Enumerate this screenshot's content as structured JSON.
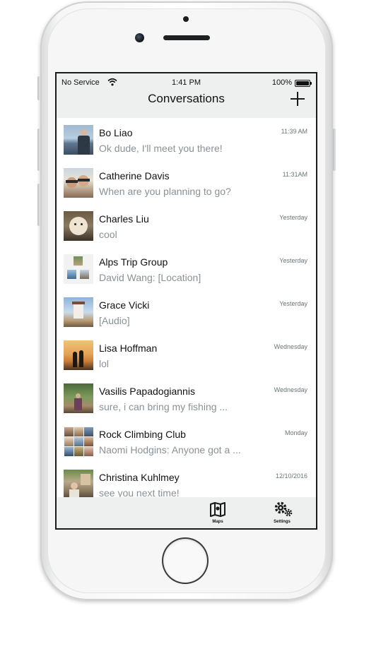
{
  "status_bar": {
    "carrier": "No Service",
    "time": "1:41 PM",
    "battery": "100%"
  },
  "nav": {
    "title": "Conversations",
    "add_icon": "plus-icon"
  },
  "conversations": [
    {
      "name": "Bo Liao",
      "preview": "Ok dude, I'll meet you there!",
      "time": "11:39 AM"
    },
    {
      "name": "Catherine Davis",
      "preview": "When are you planning to go?",
      "time": "11:31AM"
    },
    {
      "name": "Charles Liu",
      "preview": "cool",
      "time": "Yesterday"
    },
    {
      "name": "Alps Trip Group",
      "preview": "David Wang: [Location]",
      "time": "Yesterday"
    },
    {
      "name": "Grace Vicki",
      "preview": "[Audio]",
      "time": "Yesterday"
    },
    {
      "name": "Lisa Hoffman",
      "preview": "lol",
      "time": "Wednesday"
    },
    {
      "name": "Vasilis Papadogiannis",
      "preview": "sure, i can bring my fishing ...",
      "time": "Wednesday"
    },
    {
      "name": "Rock Climbing Club",
      "preview": "Naomi Hodgins: Anyone got a ...",
      "time": "Monday"
    },
    {
      "name": "Christina Kuhlmey",
      "preview": "see you next time!",
      "time": "12/10/2016"
    }
  ],
  "tabbar": {
    "maps": {
      "label": "Maps",
      "icon": "map-icon"
    },
    "settings": {
      "label": "Settings",
      "icon": "gears-icon"
    }
  },
  "colors": {
    "bar_background": "#eef0f0",
    "preview_text": "#8a9196",
    "timestamp_text": "#6d7478"
  }
}
